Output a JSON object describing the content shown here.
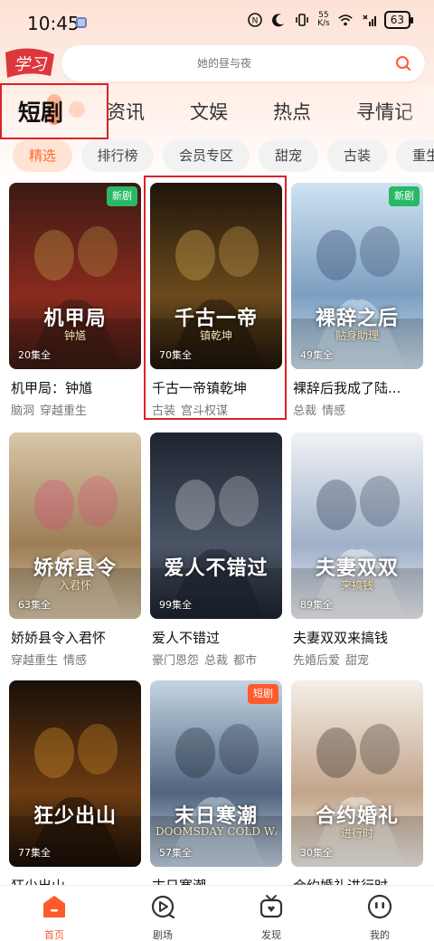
{
  "status_bar": {
    "time": "10:45",
    "speed_value": "55",
    "speed_unit": "K/s",
    "battery": "63"
  },
  "search": {
    "placeholder": "她的昼与夜"
  },
  "logo_text": "学习",
  "tabs": [
    {
      "label": "短剧",
      "active": true
    },
    {
      "label": "资讯"
    },
    {
      "label": "文娱"
    },
    {
      "label": "热点"
    },
    {
      "label": "寻情记"
    }
  ],
  "chips": [
    {
      "label": "精选",
      "active": true
    },
    {
      "label": "排行榜"
    },
    {
      "label": "会员专区"
    },
    {
      "label": "甜宠"
    },
    {
      "label": "古装"
    },
    {
      "label": "重生"
    }
  ],
  "dramas": [
    {
      "title": "机甲局：钟馗",
      "episodes": "20集全",
      "tags": [
        "脑洞",
        "穿越重生"
      ],
      "badge": "新剧",
      "poster_text": "机甲局",
      "poster_sub": "钟馗",
      "palette": [
        "#3a1b14",
        "#8a2a1e",
        "#c9a24a"
      ]
    },
    {
      "title": "千古一帝镇乾坤",
      "episodes": "70集全",
      "tags": [
        "古装",
        "宫斗权谋"
      ],
      "badge": "",
      "poster_text": "千古一帝",
      "poster_sub": "镇乾坤",
      "palette": [
        "#1f150b",
        "#6b4a1c",
        "#e0b456"
      ]
    },
    {
      "title": "裸辞后我成了陆...",
      "episodes": "49集全",
      "tags": [
        "总裁",
        "情感"
      ],
      "badge": "新剧",
      "poster_text": "裸辞之后",
      "poster_sub": "贴身助理",
      "palette": [
        "#cfe3f2",
        "#7c9ec0",
        "#2c3f63"
      ]
    },
    {
      "title": "娇娇县令入君怀",
      "episodes": "63集全",
      "tags": [
        "穿越重生",
        "情感"
      ],
      "badge": "",
      "poster_text": "娇娇县令",
      "poster_sub": "入君怀",
      "palette": [
        "#d9c7a8",
        "#9c7d56",
        "#d64a7a"
      ]
    },
    {
      "title": "爱人不错过",
      "episodes": "99集全",
      "tags": [
        "豪门恩怨",
        "总裁",
        "都市"
      ],
      "badge": "",
      "poster_text": "爱人不错过",
      "poster_sub": "",
      "palette": [
        "#1d2430",
        "#4b5566",
        "#d6d9de"
      ]
    },
    {
      "title": "夫妻双双来搞钱",
      "episodes": "89集全",
      "tags": [
        "先婚后爱",
        "甜宠"
      ],
      "badge": "",
      "poster_text": "夫妻双双",
      "poster_sub": "来搞钱",
      "palette": [
        "#f1f3f6",
        "#9fb0c8",
        "#2a3550"
      ]
    },
    {
      "title": "狂少出山",
      "episodes": "77集全",
      "tags": [],
      "badge": "",
      "poster_text": "狂少出山",
      "poster_sub": "",
      "palette": [
        "#1a0f08",
        "#6c3c12",
        "#e39b2a"
      ]
    },
    {
      "title": "末日寒潮",
      "episodes": "57集全",
      "tags": [],
      "badge": "短剧",
      "poster_text": "末日寒潮",
      "poster_sub": "DOOMSDAY COLD WAVE",
      "palette": [
        "#c4d4e4",
        "#50657e",
        "#1b2535"
      ]
    },
    {
      "title": "合约婚礼进行时",
      "episodes": "30集全",
      "tags": [],
      "badge": "",
      "poster_text": "合约婚礼",
      "poster_sub": "进行时",
      "palette": [
        "#f4efe8",
        "#c2a58a",
        "#2a1f1c"
      ]
    }
  ],
  "bottom_nav": [
    {
      "label": "首页",
      "active": true,
      "icon": "home-icon"
    },
    {
      "label": "剧场",
      "icon": "theater-icon"
    },
    {
      "label": "发现",
      "icon": "discover-icon"
    },
    {
      "label": "我的",
      "icon": "profile-icon"
    }
  ],
  "colors": {
    "accent": "#ff5a2c",
    "badge_new": "#29b866",
    "highlight_box": "#d8232a"
  }
}
